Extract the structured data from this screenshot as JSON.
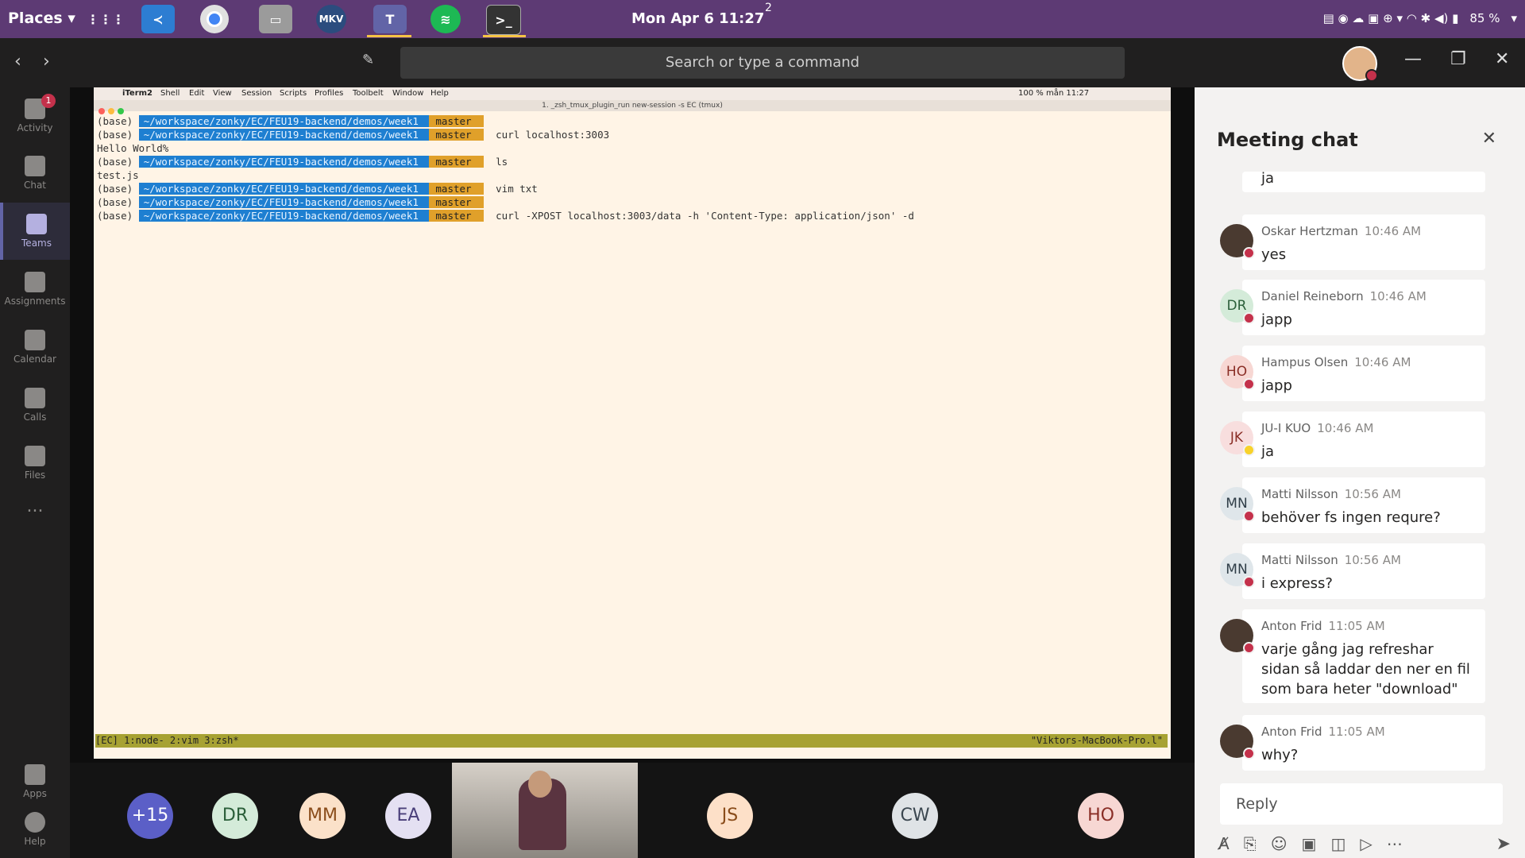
{
  "topbar": {
    "places": "Places ▾",
    "clock": "Mon Apr 6  11:27",
    "notif_badge": "2",
    "battery": "85 %",
    "apps": [
      "grid",
      "vscode",
      "chrome",
      "files",
      "mkv",
      "teams",
      "spotify",
      "terminal"
    ]
  },
  "teams": {
    "search_placeholder": "Search or type a command",
    "rail": [
      {
        "label": "Activity",
        "badge": "1"
      },
      {
        "label": "Chat"
      },
      {
        "label": "Teams"
      },
      {
        "label": "Assignments"
      },
      {
        "label": "Calendar"
      },
      {
        "label": "Calls"
      },
      {
        "label": "Files"
      },
      {
        "label": "..."
      },
      {
        "label": "Apps"
      },
      {
        "label": "Help"
      }
    ]
  },
  "mac": {
    "menu": [
      "iTerm2",
      "Shell",
      "Edit",
      "View",
      "Session",
      "Scripts",
      "Profiles",
      "Toolbelt",
      "Window",
      "Help"
    ],
    "menu_right": "100 %  mån 11:27",
    "title": "1. _zsh_tmux_plugin_run new-session -s EC (tmux)",
    "terminal": {
      "path": "~/workspace/zonky/EC/FEU19-backend/demos/week1",
      "branch": "master",
      "base": "(base)",
      "lines": [
        {
          "type": "prompt",
          "cmd": ""
        },
        {
          "type": "prompt",
          "cmd": "curl localhost:3003"
        },
        {
          "type": "out",
          "text": "Hello World%"
        },
        {
          "type": "prompt",
          "cmd": "ls"
        },
        {
          "type": "out",
          "text": "test.js"
        },
        {
          "type": "prompt",
          "cmd": "vim txt"
        },
        {
          "type": "prompt",
          "cmd": ""
        },
        {
          "type": "prompt",
          "cmd": "curl -XPOST localhost:3003/data -h 'Content-Type: application/json' -d"
        }
      ]
    },
    "status_left": "[EC] 1:node- 2:vim  3:zsh*",
    "status_right": "\"Viktors-MacBook-Pro.l\""
  },
  "participants": [
    {
      "initials": "+15",
      "bg": "#5b5fc7",
      "fg": "#ffffff"
    },
    {
      "initials": "DR",
      "bg": "#d4ebd9",
      "fg": "#2b5f3a"
    },
    {
      "initials": "MM",
      "bg": "#fbe1c9",
      "fg": "#8a4c1a"
    },
    {
      "initials": "EA",
      "bg": "#e4e0f2",
      "fg": "#4a3f7a"
    },
    {
      "initials": "JS",
      "bg": "#fde0c8",
      "fg": "#8a4c1a"
    },
    {
      "initials": "CW",
      "bg": "#dfe3e6",
      "fg": "#3b4750"
    },
    {
      "initials": "HO",
      "bg": "#f7d7d3",
      "fg": "#8a2e26"
    }
  ],
  "chat": {
    "title": "Meeting chat",
    "reply_placeholder": "Reply",
    "messages": [
      {
        "sender": "",
        "time": "",
        "text": "ja",
        "initials": ""
      },
      {
        "sender": "Oskar Hertzman",
        "time": "10:46 AM",
        "text": "yes",
        "initials": "",
        "photo": true,
        "status": "busy"
      },
      {
        "sender": "Daniel Reineborn",
        "time": "10:46 AM",
        "text": "japp",
        "initials": "DR",
        "status": "busy"
      },
      {
        "sender": "Hampus Olsen",
        "time": "10:46 AM",
        "text": "japp",
        "initials": "HO",
        "status": "busy"
      },
      {
        "sender": "JU-I KUO",
        "time": "10:46 AM",
        "text": "ja",
        "initials": "JK",
        "status": "away"
      },
      {
        "sender": "Matti Nilsson",
        "time": "10:56 AM",
        "text": "behöver fs ingen requre?",
        "initials": "MN",
        "status": "busy"
      },
      {
        "sender": "Matti Nilsson",
        "time": "10:56 AM",
        "text": "i express?",
        "initials": "MN",
        "status": "busy"
      },
      {
        "sender": "Anton Frid",
        "time": "11:05 AM",
        "text": "varje gång jag refreshar sidan så laddar den ner en fil som bara heter \"download\"",
        "initials": "",
        "photo": true,
        "status": "busy"
      },
      {
        "sender": "Anton Frid",
        "time": "11:05 AM",
        "text": "why?",
        "initials": "",
        "photo": true,
        "status": "busy"
      }
    ]
  }
}
